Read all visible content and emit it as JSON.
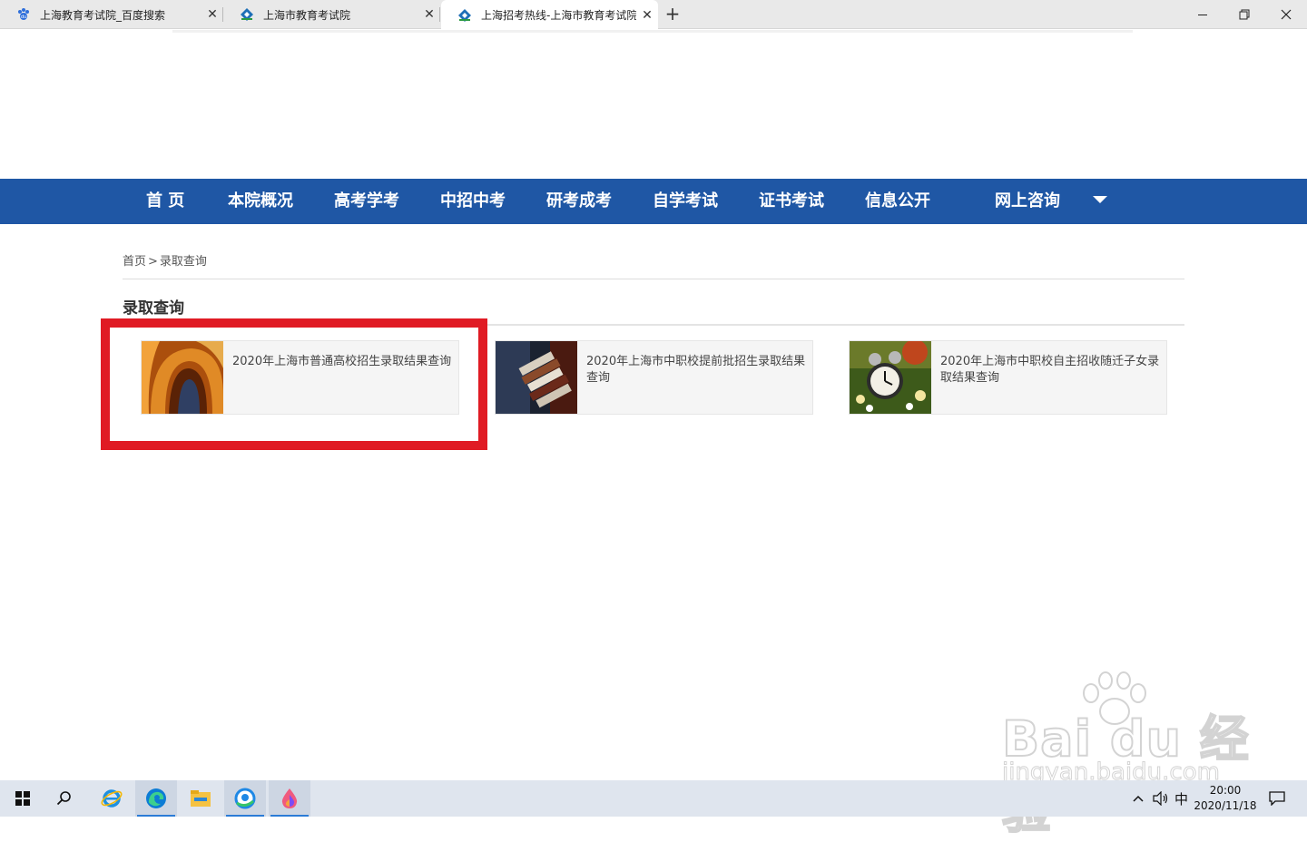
{
  "browser": {
    "tabs": [
      {
        "title": "上海教育考试院_百度搜索",
        "icon": "baidu-paw-icon",
        "active": false
      },
      {
        "title": "上海市教育考试院",
        "icon": "sheea-logo-icon",
        "active": false
      },
      {
        "title": "上海招考热线-上海市教育考试院",
        "icon": "sheea-logo-icon",
        "active": true
      }
    ],
    "new_tab": "+",
    "close_glyph": "✕",
    "window_controls": {
      "minimize": "—",
      "maximize": "❐",
      "close": "✕"
    }
  },
  "nav": {
    "items": [
      "首 页",
      "本院概况",
      "高考学考",
      "中招中考",
      "研考成考",
      "自学考试",
      "证书考试",
      "信息公开",
      "网上咨询"
    ],
    "dropdown_icon": "caret-down-icon",
    "background": "#1f57a5"
  },
  "breadcrumb": {
    "home": "首页",
    "separator": ">",
    "current": "录取查询"
  },
  "section": {
    "title": "录取查询"
  },
  "cards": [
    {
      "text": "2020年上海市普通高校招生录取结果查询",
      "image": "arch-photo"
    },
    {
      "text": "2020年上海市中职校提前批招生录取结果查询",
      "image": "books-photo"
    },
    {
      "text": "2020年上海市中职校自主招收随迁子女录取结果查询",
      "image": "alarm-clock-photo"
    }
  ],
  "highlight": {
    "color": "#e01b24"
  },
  "watermark": {
    "logo": "Bai du 经验",
    "url": "jingyan.baidu.com"
  },
  "taskbar": {
    "apps": [
      "windows-start-icon",
      "search-icon",
      "ie-icon",
      "edge-icon",
      "file-explorer-icon",
      "qq-browser-icon",
      "paint-icon"
    ],
    "tray": {
      "ime": "中",
      "time": "20:00",
      "date": "2020/11/18"
    }
  }
}
